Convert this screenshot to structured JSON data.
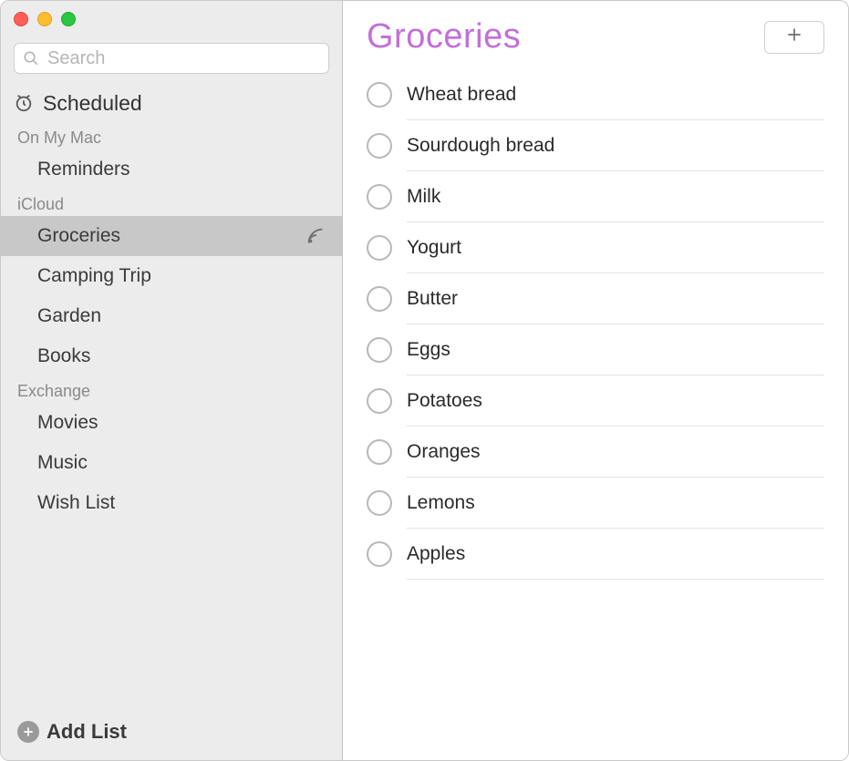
{
  "search": {
    "placeholder": "Search"
  },
  "sidebar": {
    "scheduled_label": "Scheduled",
    "groups": [
      {
        "header": "On My Mac",
        "items": [
          {
            "label": "Reminders",
            "selected": false,
            "shared": false
          }
        ]
      },
      {
        "header": "iCloud",
        "items": [
          {
            "label": "Groceries",
            "selected": true,
            "shared": true
          },
          {
            "label": "Camping Trip",
            "selected": false,
            "shared": false
          },
          {
            "label": "Garden",
            "selected": false,
            "shared": false
          },
          {
            "label": "Books",
            "selected": false,
            "shared": false
          }
        ]
      },
      {
        "header": "Exchange",
        "items": [
          {
            "label": "Movies",
            "selected": false,
            "shared": false
          },
          {
            "label": "Music",
            "selected": false,
            "shared": false
          },
          {
            "label": "Wish List",
            "selected": false,
            "shared": false
          }
        ]
      }
    ],
    "add_list_label": "Add List"
  },
  "main": {
    "title": "Groceries",
    "title_color": "#c36fd9",
    "items": [
      {
        "title": "Wheat bread",
        "completed": false
      },
      {
        "title": "Sourdough bread",
        "completed": false
      },
      {
        "title": "Milk",
        "completed": false
      },
      {
        "title": "Yogurt",
        "completed": false
      },
      {
        "title": "Butter",
        "completed": false
      },
      {
        "title": "Eggs",
        "completed": false
      },
      {
        "title": "Potatoes",
        "completed": false
      },
      {
        "title": "Oranges",
        "completed": false
      },
      {
        "title": "Lemons",
        "completed": false
      },
      {
        "title": "Apples",
        "completed": false
      }
    ]
  }
}
